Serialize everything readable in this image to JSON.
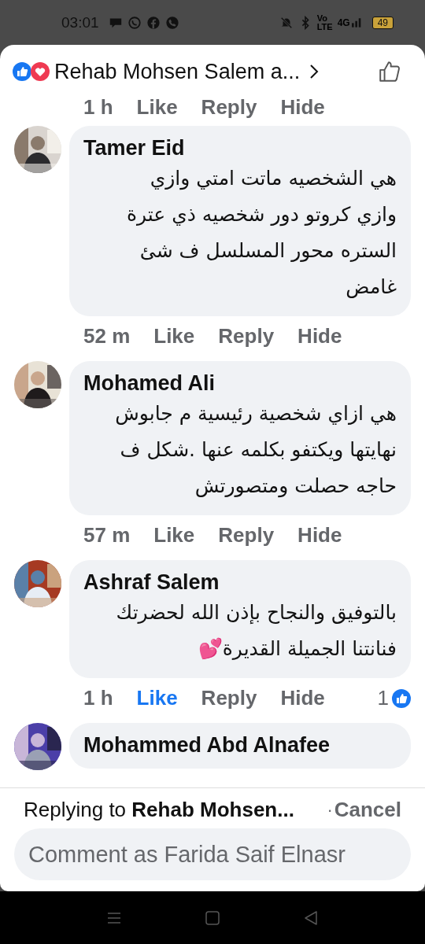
{
  "status_bar": {
    "time": "03:01",
    "volte_top": "Vo",
    "volte_bottom": "LTE",
    "network": "4G",
    "battery": "49"
  },
  "header": {
    "reactions": [
      {
        "kind": "like"
      },
      {
        "kind": "love"
      }
    ],
    "title": "Rehab Mohsen Salem a..."
  },
  "previous_actions": {
    "time": "1 h",
    "like": "Like",
    "reply": "Reply",
    "hide": "Hide"
  },
  "comments": [
    {
      "author": "Tamer Eid",
      "text": "هي الشخصيه ماتت امتي وازي وازي كروتو دور شخصيه ذي عترة الستره محور المسلسل ف شئ غامض",
      "time": "52 m",
      "like": "Like",
      "reply": "Reply",
      "hide": "Hide",
      "liked": false
    },
    {
      "author": "Mohamed Ali",
      "text": "هي ازاي شخصية رئيسية م جابوش نهايتها ويكتفو بكلمه عنها .شكل ف حاجه حصلت ومتصورتش",
      "time": "57 m",
      "like": "Like",
      "reply": "Reply",
      "hide": "Hide",
      "liked": false
    },
    {
      "author": "Ashraf Salem",
      "text": "بالتوفيق والنجاح بإذن الله لحضرتك فنانتنا الجميلة القديرة💕",
      "time": "1 h",
      "like": "Like",
      "reply": "Reply",
      "hide": "Hide",
      "liked": true,
      "reaction_count": "1"
    },
    {
      "author": "Mohammed Abd Alnafee"
    }
  ],
  "reply_bar": {
    "prefix": "Replying to",
    "name": "Rehab Mohsen...",
    "separator": "·",
    "cancel": "Cancel"
  },
  "comment_input": {
    "placeholder": "Comment as Farida Saif Elnasr"
  }
}
